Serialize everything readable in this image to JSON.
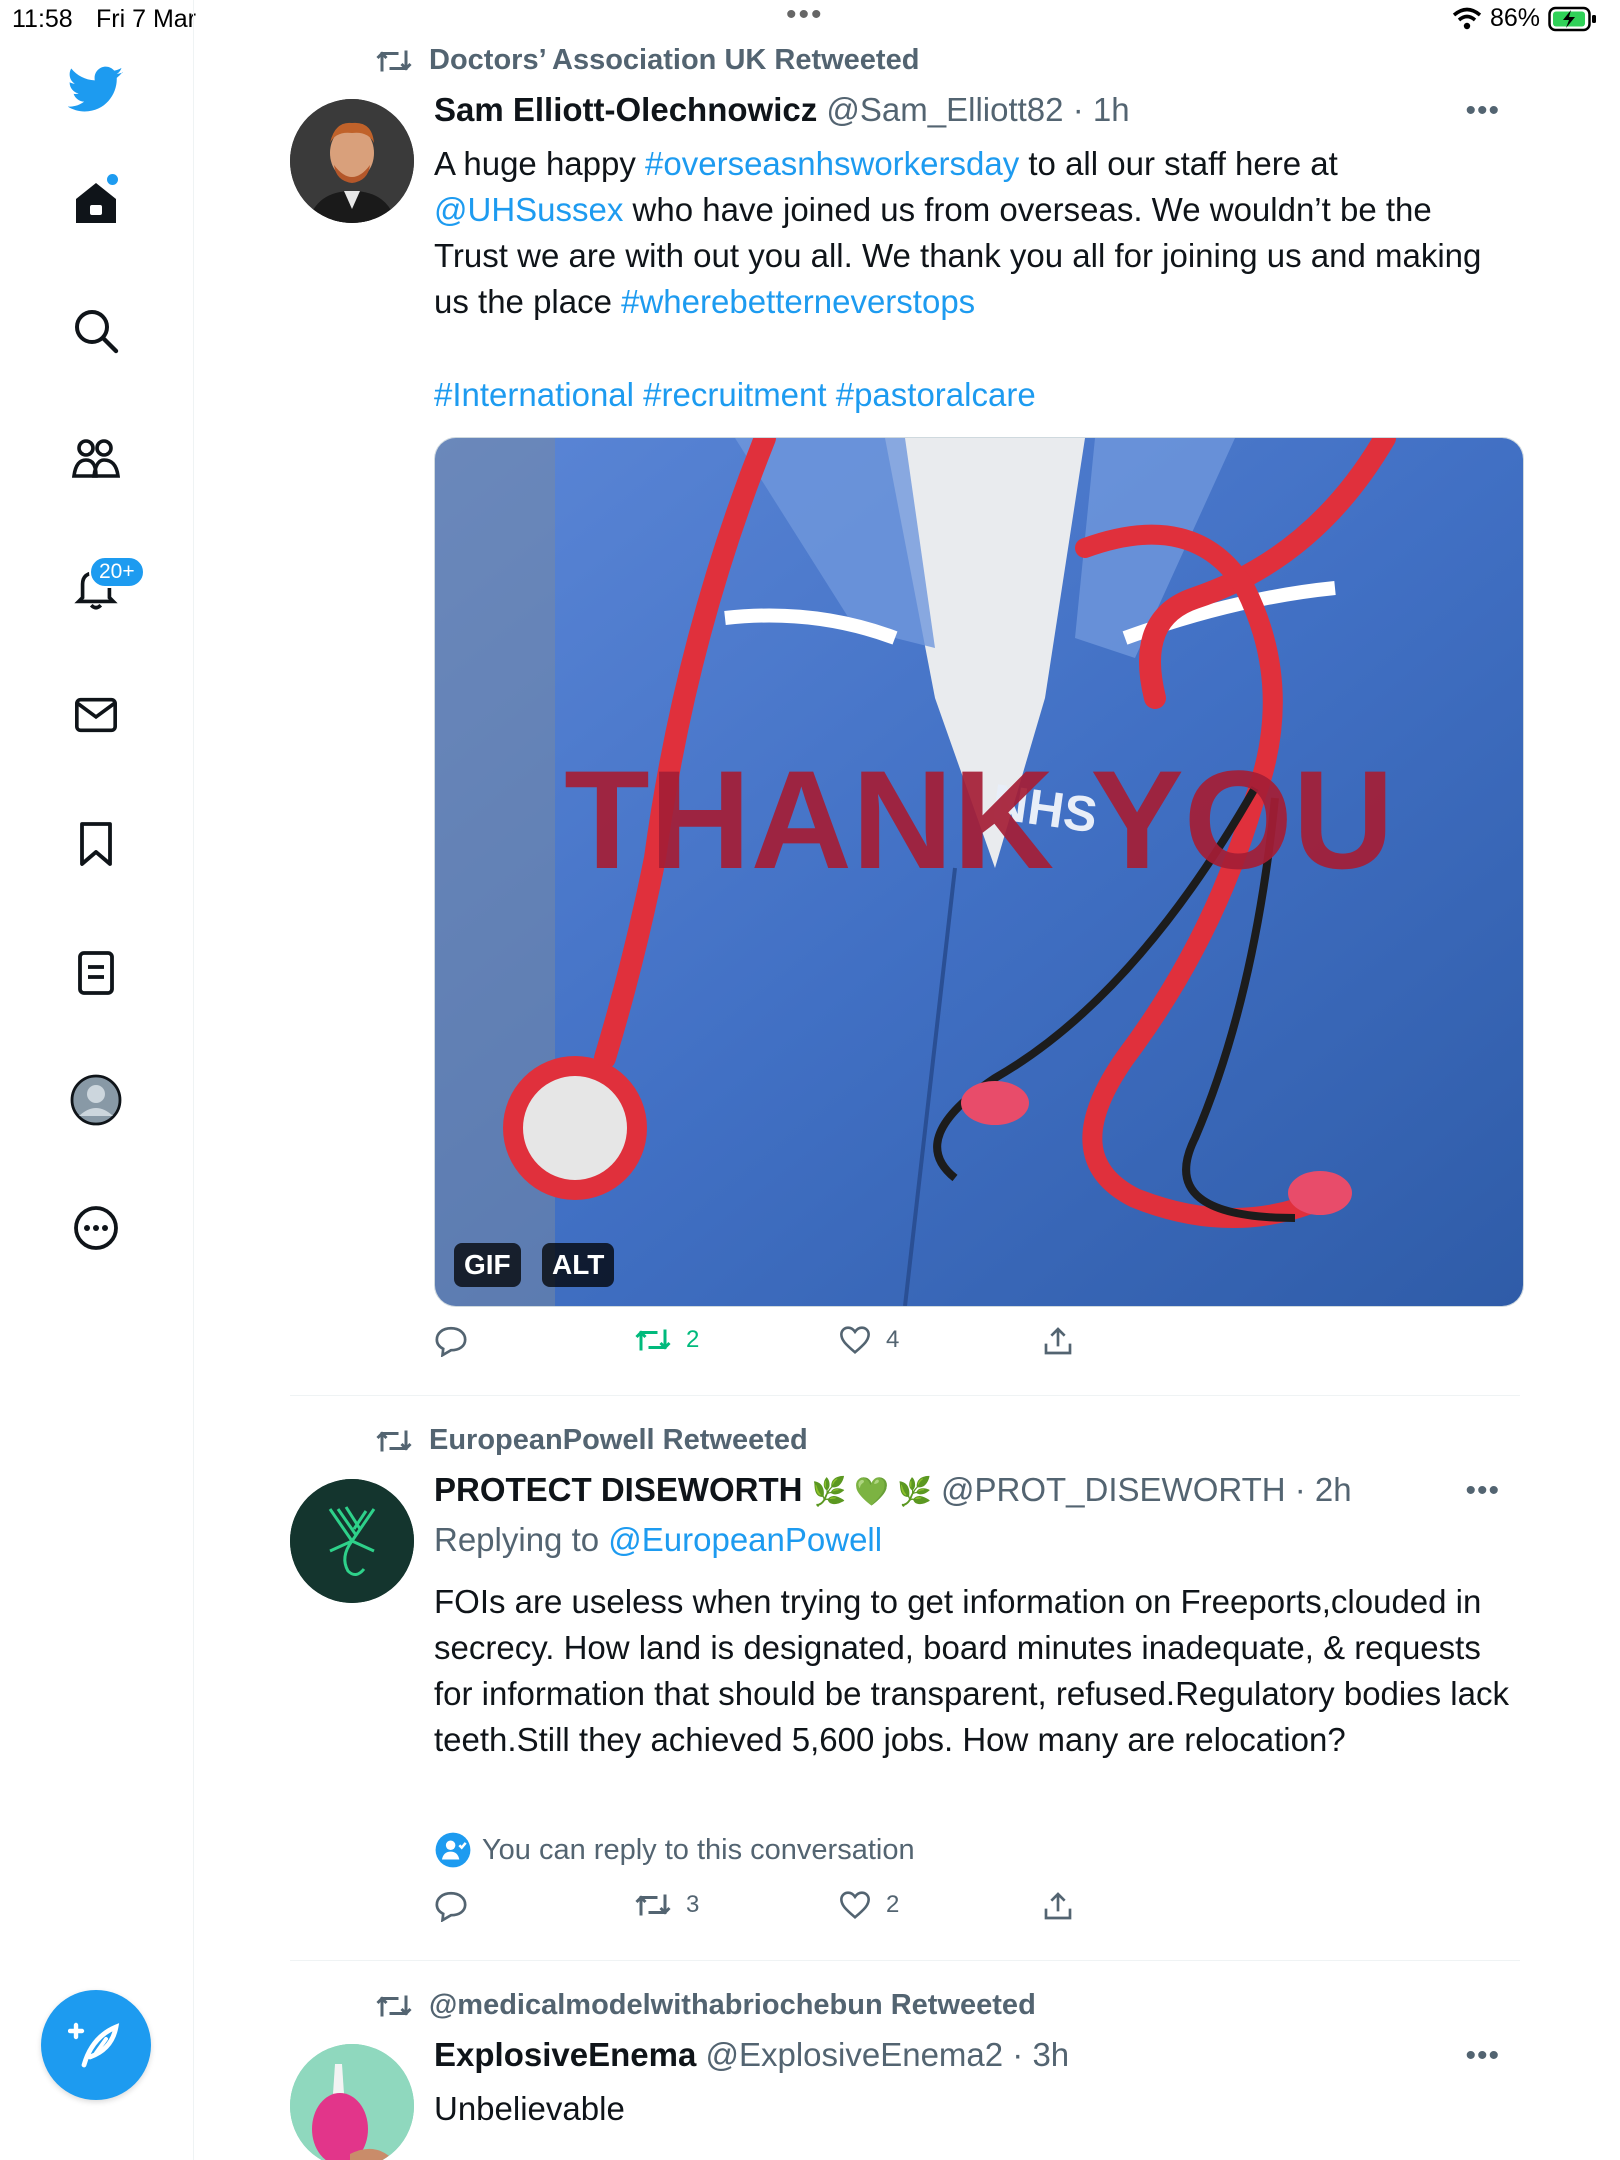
{
  "status_bar": {
    "time": "11:58",
    "date": "Fri 7 Mar",
    "dots": "•••",
    "battery": "86%"
  },
  "sidebar": {
    "notifications_badge": "20+"
  },
  "tweets": [
    {
      "retweeted_by": "Doctors’ Association UK Retweeted",
      "name": "Sam Elliott-Olechnowicz",
      "handle": "@Sam_Elliott82",
      "time": "· 1h",
      "text": [
        {
          "t": "A huge happy "
        },
        {
          "t": "#overseasnhsworkersday",
          "link": true
        },
        {
          "t": " to all our staff here at "
        },
        {
          "t": "@UHSussex",
          "link": true
        },
        {
          "t": " who have joined us from overseas. We wouldn’t be the Trust we are with out you all. We thank you all for joining us and making us the place "
        },
        {
          "t": "#wherebetterneverstops",
          "link": true
        }
      ],
      "tags_line": "#International #recruitment #pastoralcare",
      "media": {
        "overlay_text": "THANK YOU",
        "shirt_text": "NHS",
        "gif_label": "GIF",
        "alt_label": "ALT"
      },
      "retweets": "2",
      "likes": "4"
    },
    {
      "retweeted_by": "EuropeanPowell Retweeted",
      "name": "PROTECT DISEWORTH",
      "emojis": "🌿 💚 🌿",
      "handle": "@PROT_DISEWORTH",
      "time": "· 2h",
      "replying_prefix": "Replying to ",
      "replying_to": "@EuropeanPowell",
      "text": "FOIs are useless when trying to get information on Freeports,clouded in secrecy.  How land is designated, board minutes inadequate, & requests for information that should be transparent, refused.Regulatory bodies lack teeth.Still they achieved 5,600 jobs. How many are relocation?",
      "reply_notice": "You can reply to this conversation",
      "retweets": "3",
      "likes": "2"
    },
    {
      "retweeted_by": "@medicalmodelwithabriochebun Retweeted",
      "name": "ExplosiveEnema",
      "handle": "@ExplosiveEnema2",
      "time": "· 3h",
      "text": "Unbelievable"
    }
  ],
  "colors": {
    "accent": "#1d9bf0",
    "retweet_green": "#00ba7c",
    "secondary": "#536471"
  }
}
